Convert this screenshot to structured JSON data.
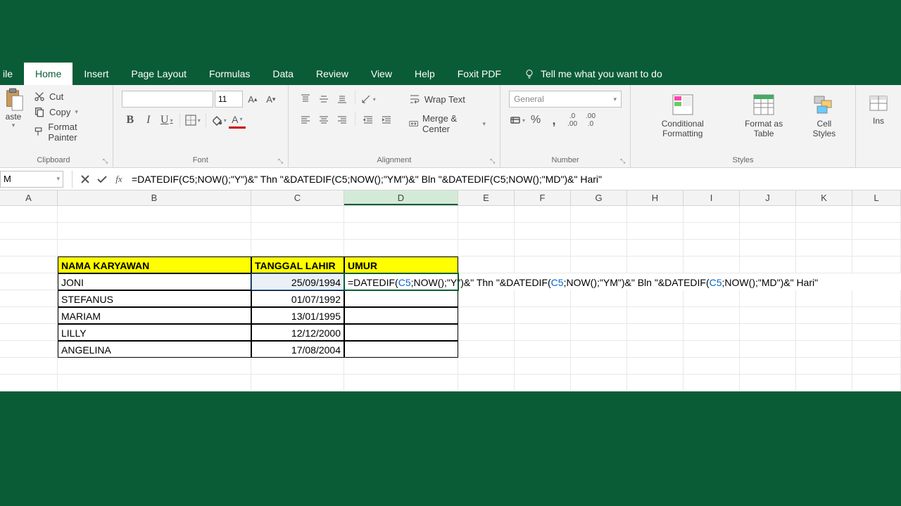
{
  "tabs": {
    "file": "ile",
    "home": "Home",
    "insert": "Insert",
    "page_layout": "Page Layout",
    "formulas": "Formulas",
    "data": "Data",
    "review": "Review",
    "view": "View",
    "help": "Help",
    "foxit": "Foxit PDF",
    "tellme": "Tell me what you want to do"
  },
  "ribbon": {
    "clipboard": {
      "paste": "aste",
      "cut": "Cut",
      "copy": "Copy",
      "format_painter": "Format Painter",
      "label": "Clipboard"
    },
    "font": {
      "name": "",
      "size": "11",
      "label": "Font"
    },
    "alignment": {
      "wrap": "Wrap Text",
      "merge": "Merge & Center",
      "label": "Alignment"
    },
    "number": {
      "format": "General",
      "label": "Number"
    },
    "styles": {
      "conditional": "Conditional Formatting",
      "format_table": "Format as Table",
      "cell_styles": "Cell Styles",
      "label": "Styles"
    },
    "cells": {
      "insert": "Ins"
    }
  },
  "formulabar": {
    "namebox": "M",
    "formula": "=DATEDIF(C5;NOW();\"Y\")&\" Thn \"&DATEDIF(C5;NOW();\"YM\")&\" Bln \"&DATEDIF(C5;NOW();\"MD\")&\" Hari\""
  },
  "columns": [
    "A",
    "B",
    "C",
    "D",
    "E",
    "F",
    "G",
    "H",
    "I",
    "J",
    "K",
    "L"
  ],
  "sheet": {
    "headers": {
      "b": "NAMA KARYAWAN",
      "c": "TANGGAL LAHIR",
      "d": "UMUR"
    },
    "rows": [
      {
        "name": "JONI",
        "date": "25/09/1994"
      },
      {
        "name": "STEFANUS",
        "date": "01/07/1992"
      },
      {
        "name": "MARIAM",
        "date": "13/01/1995"
      },
      {
        "name": "LILLY",
        "date": "12/12/2000"
      },
      {
        "name": "ANGELINA",
        "date": "17/08/2004"
      }
    ]
  },
  "editing_formula": {
    "p1": "=DATEDIF(",
    "r1": "C5",
    "p2": ";NOW()",
    "p3": ";\"Y\")&\" Thn \"&DATEDIF(",
    "r2": "C5",
    "p4": ";NOW()",
    "p5": ";\"YM\")&\" Bln \"&DATEDIF(",
    "r3": "C5",
    "p6": ";NOW()",
    "p7": ";\"MD\")&\" Hari\""
  }
}
